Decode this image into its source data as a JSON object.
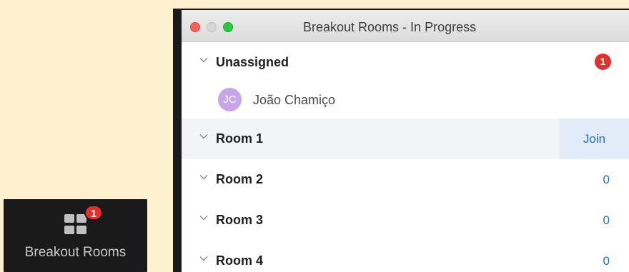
{
  "toolbar": {
    "breakout_label": "Breakout Rooms",
    "badge_count": "1",
    "icon": "grid-icon"
  },
  "window": {
    "title": "Breakout Rooms - In Progress"
  },
  "unassigned": {
    "label": "Unassigned",
    "badge": "1",
    "participant": {
      "initials": "JC",
      "name": "João Chamiço"
    }
  },
  "rooms": [
    {
      "label": "Room 1",
      "action": "Join"
    },
    {
      "label": "Room 2",
      "count": "0"
    },
    {
      "label": "Room 3",
      "count": "0"
    },
    {
      "label": "Room 4",
      "count": "0"
    }
  ],
  "colors": {
    "page_background": "#fff1cf",
    "accent_blue": "#1a6fd6",
    "alert_red": "#e3302f",
    "avatar_purple": "#c7a6e8"
  }
}
